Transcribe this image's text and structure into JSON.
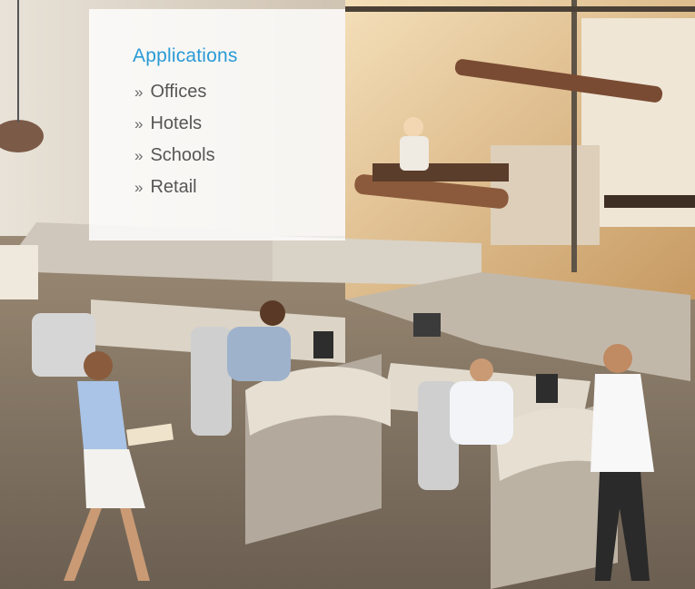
{
  "applications": {
    "title": "Applications",
    "marker": "»",
    "items": [
      {
        "label": "Offices"
      },
      {
        "label": "Hotels"
      },
      {
        "label": "Schools"
      },
      {
        "label": "Retail"
      }
    ]
  },
  "colors": {
    "title_accent": "#2a9ad6",
    "item_text": "#565656"
  }
}
